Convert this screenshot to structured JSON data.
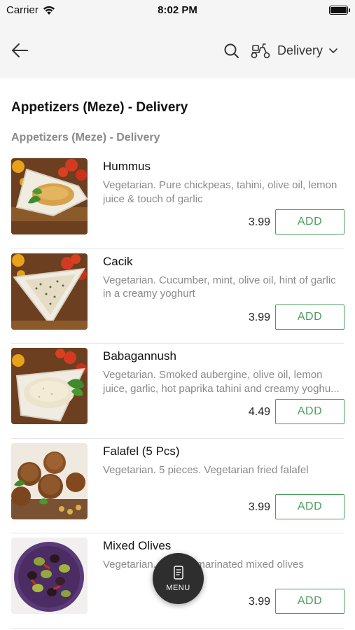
{
  "status_bar": {
    "carrier": "Carrier",
    "time": "8:02 PM"
  },
  "header": {
    "back_icon": "arrow-left-icon",
    "search_icon": "search-icon",
    "delivery_icon": "scooter-icon",
    "delivery_label": "Delivery",
    "chevron_icon": "chevron-down-icon"
  },
  "page_title": "Appetizers (Meze) - Delivery",
  "section_title": "Appetizers (Meze) - Delivery",
  "items": [
    {
      "name": "Hummus",
      "description": "Vegetarian. Pure chickpeas, tahini, olive oil, lemon juice & touch of garlic",
      "price": "3.99",
      "add_label": "ADD"
    },
    {
      "name": "Cacik",
      "description": "Vegetarian. Cucumber, mint, olive oil, hint of garlic in a creamy yoghurt",
      "price": "3.99",
      "add_label": "ADD"
    },
    {
      "name": "Babagannush",
      "description": "Vegetarian. Smoked aubergine, olive oil, lemon juice, garlic, hot paprika tahini and creamy yoghu...",
      "price": "4.49",
      "add_label": "ADD"
    },
    {
      "name": "Falafel (5 Pcs)",
      "description": "Vegetarian. 5 pieces. Vegetarian fried falafel",
      "price": "3.99",
      "add_label": "ADD"
    },
    {
      "name": "Mixed Olives",
      "description": "Vegetarian. Bowl of marinated mixed olives",
      "price": "3.99",
      "add_label": "ADD"
    }
  ],
  "fab": {
    "label": "MENU",
    "icon": "menu-card-icon"
  },
  "colors": {
    "accent_green": "#4a9d5b",
    "header_bg": "#f5f5f5",
    "fab_bg": "#2e2e2e"
  }
}
